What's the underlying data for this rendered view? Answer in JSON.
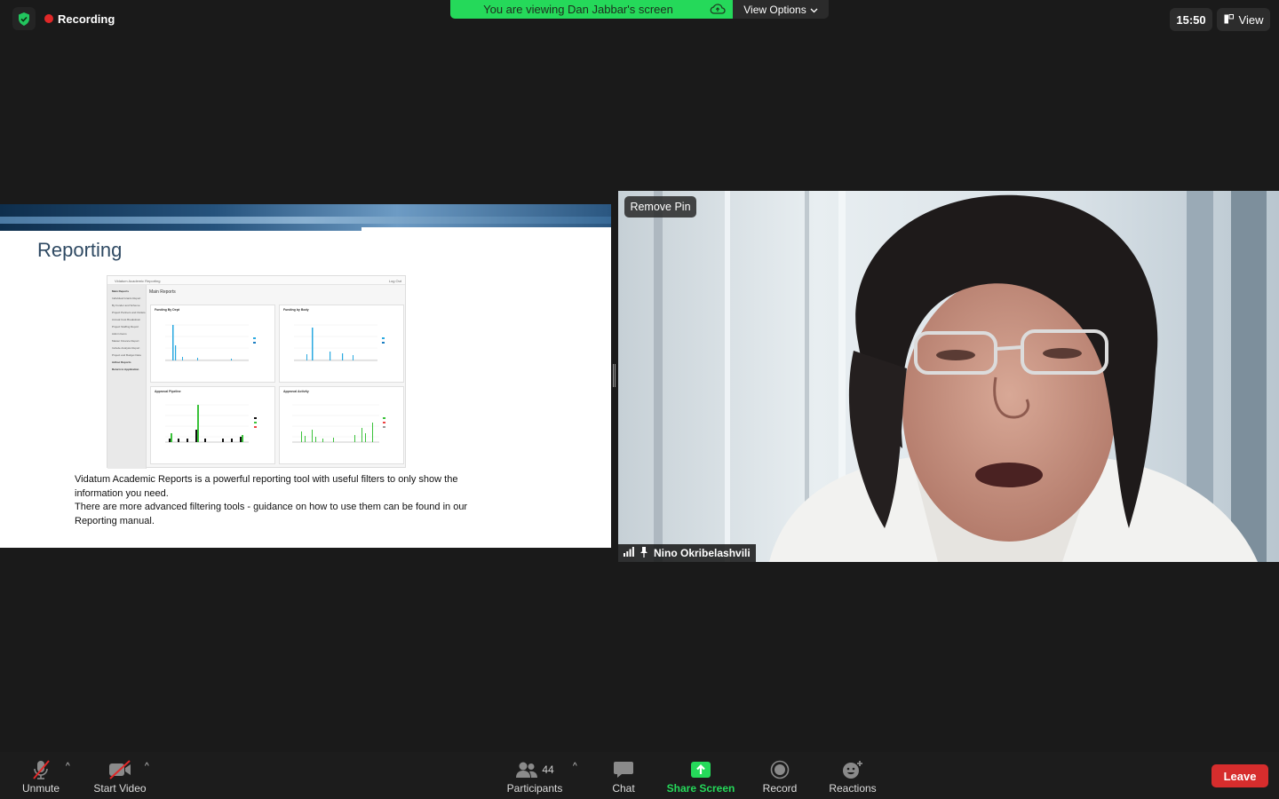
{
  "top": {
    "recording_label": "Recording",
    "viewing_banner": "You are viewing Dan Jabbar's screen",
    "view_options_label": "View Options",
    "clock": "15:50",
    "view_label": "View"
  },
  "slide": {
    "title": "Reporting",
    "screenshot": {
      "app_title": "Vidatum Academic Reporting",
      "logout": "Log Out",
      "main_title": "Main Reports",
      "sidebar_items": [
        "Main Reports",
        "Individual Grants Report",
        "By Funder and Scheme",
        "Project Partners and Outlets",
        "Annual Cost Breakdown",
        "Project Staffing Report",
        "Admin Items",
        "Master Finance Report",
        "Include Analysis Report",
        "Project and Budget Data",
        "Adhoc Reports",
        "Return to Application"
      ],
      "panels": [
        "Funding By Dept",
        "Funding by Body",
        "Approval Pipeline",
        "Approval Activity"
      ]
    },
    "body_lines": [
      "Vidatum Academic Reports is a powerful reporting tool with useful filters to only show the",
      "information you need.",
      "There are more advanced filtering tools - guidance on how to use them can be found in our",
      "Reporting manual."
    ]
  },
  "video": {
    "remove_pin_label": "Remove Pin",
    "participant_name": "Nino Okribelashvili"
  },
  "toolbar": {
    "unmute": "Unmute",
    "start_video": "Start Video",
    "participants": "Participants",
    "participants_count": "44",
    "chat": "Chat",
    "share_screen": "Share Screen",
    "record": "Record",
    "reactions": "Reactions",
    "leave": "Leave"
  },
  "colors": {
    "accent_green": "#25d95a",
    "leave_red": "#d62d2d",
    "record_red": "#e02828"
  }
}
